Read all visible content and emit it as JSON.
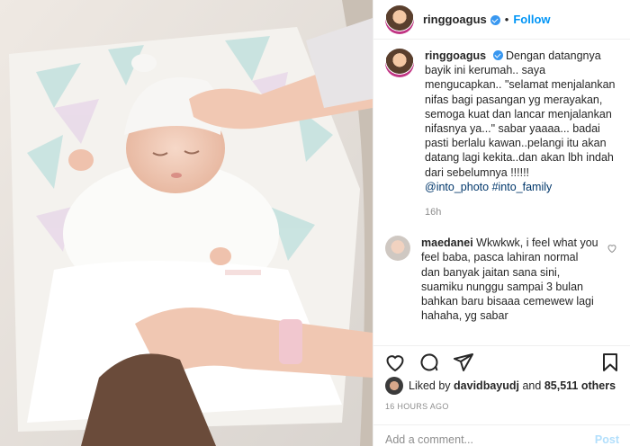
{
  "post": {
    "username": "ringgoagus",
    "follow_label": "Follow",
    "separator": "•"
  },
  "caption": {
    "username": "ringgoagus",
    "text": "Dengan datangnya bayik ini kerumah.. saya mengucapkan.. \"selamat menjalankan nifas bagi pasangan yg merayakan, semoga kuat dan lancar menjalankan nifasnya ya...\" sabar yaaaa... badai pasti berlalu kawan..pelangi itu akan datang lagi kekita..dan akan lbh indah dari sebelumnya !!!!!!",
    "tag1": "@into_photo",
    "tag2": "#into_family",
    "time": "16h"
  },
  "comment": {
    "username": "maedanei",
    "text": "Wkwkwk, i feel what you feel baba, pasca lahiran normal dan banyak jaitan sana sini, suamiku nunggu sampai 3 bulan bahkan baru bisaaa cemewew lagi hahaha, yg sabar"
  },
  "likes": {
    "prefix": "Liked by",
    "user": "davidbayudj",
    "middle": "and",
    "count": "85,511 others"
  },
  "posted_ago": "16 HOURS AGO",
  "add_comment": {
    "placeholder": "Add a comment...",
    "post_label": "Post"
  },
  "icons": {
    "like": "heart-icon",
    "comment": "comment-icon",
    "share": "share-icon",
    "save": "bookmark-icon"
  },
  "colors": {
    "accent": "#0095f6",
    "verified": "#3897f0",
    "muted": "#8e8e8e"
  }
}
